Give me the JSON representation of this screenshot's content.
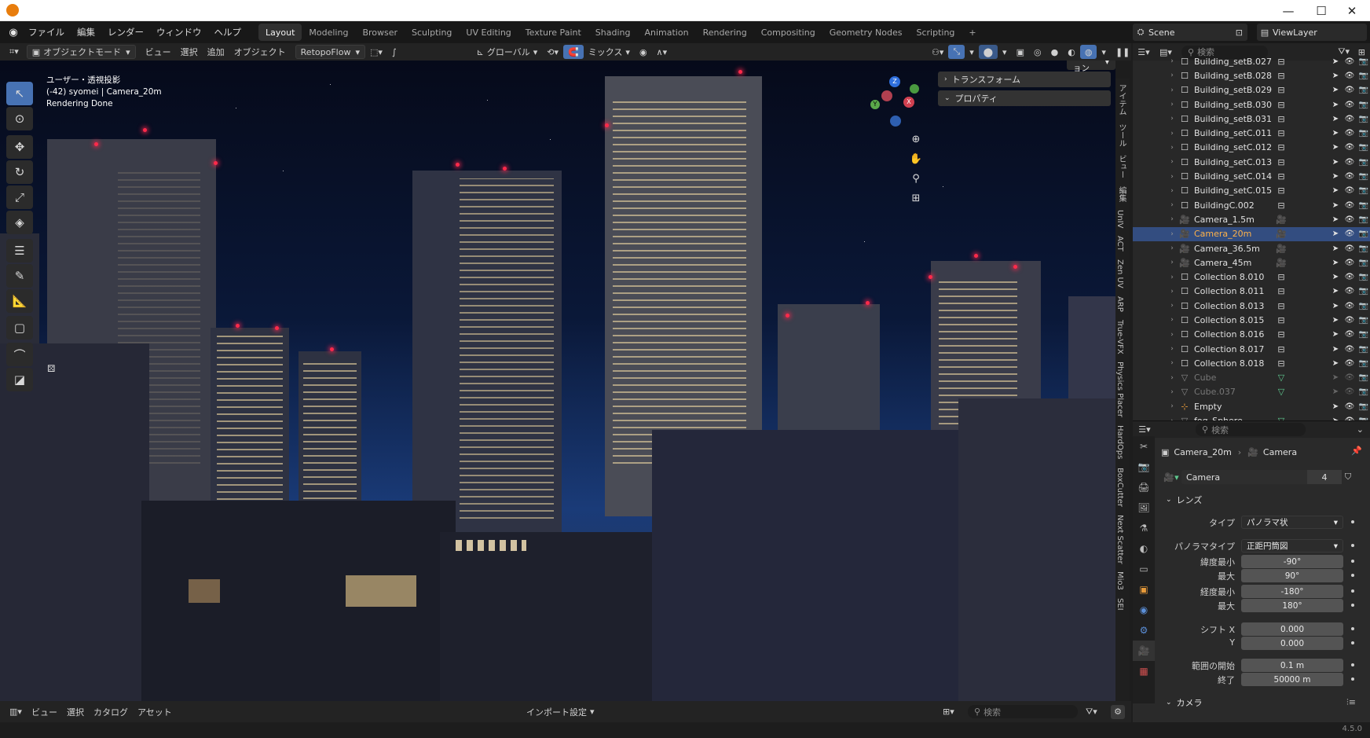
{
  "titlebar": {
    "min": "—",
    "max": "☐",
    "close": "✕"
  },
  "menus": [
    "ファイル",
    "編集",
    "レンダー",
    "ウィンドウ",
    "ヘルプ"
  ],
  "workspaces": [
    "Layout",
    "Modeling",
    "Browser",
    "Sculpting",
    "UV Editing",
    "Texture Paint",
    "Shading",
    "Animation",
    "Rendering",
    "Compositing",
    "Geometry Nodes",
    "Scripting"
  ],
  "add_ws": "+",
  "scene": "Scene",
  "viewlayer": "ViewLayer",
  "viewport_header": {
    "mode": "オブジェクトモード",
    "menus": [
      "ビュー",
      "選択",
      "追加",
      "オブジェクト"
    ],
    "addon": "RetopoFlow",
    "transform": "グローバル",
    "snap": "ミックス"
  },
  "options_button": "オプション",
  "overlay": {
    "line1": "ユーザー・透視投影",
    "line2": "(-42) syomei | Camera_20m",
    "line3": "Rendering Done"
  },
  "n_panels": [
    "トランスフォーム",
    "プロパティ"
  ],
  "vertical_tabs": [
    "アイテム",
    "ツール",
    "ビュー",
    "編集",
    "UnIV",
    "ACT",
    "Zen UV",
    "ARP",
    "True-VFX",
    "Physics Placer",
    "HardOps",
    "BoxCutter",
    "Next Scatter",
    "Mio3",
    "SEI"
  ],
  "outliner": {
    "search_placeholder": "検索",
    "rows": [
      {
        "name": "Building_setB.027",
        "type": "collection",
        "sel": false,
        "dim": false
      },
      {
        "name": "Building_setB.028",
        "type": "collection",
        "sel": false,
        "dim": false
      },
      {
        "name": "Building_setB.029",
        "type": "collection",
        "sel": false,
        "dim": false
      },
      {
        "name": "Building_setB.030",
        "type": "collection",
        "sel": false,
        "dim": false
      },
      {
        "name": "Building_setB.031",
        "type": "collection",
        "sel": false,
        "dim": false
      },
      {
        "name": "Building_setC.011",
        "type": "collection",
        "sel": false,
        "dim": false
      },
      {
        "name": "Building_setC.012",
        "type": "collection",
        "sel": false,
        "dim": false
      },
      {
        "name": "Building_setC.013",
        "type": "collection",
        "sel": false,
        "dim": false
      },
      {
        "name": "Building_setC.014",
        "type": "collection",
        "sel": false,
        "dim": false
      },
      {
        "name": "Building_setC.015",
        "type": "collection",
        "sel": false,
        "dim": false
      },
      {
        "name": "BuildingC.002",
        "type": "collection",
        "sel": false,
        "dim": false
      },
      {
        "name": "Camera_1.5m",
        "type": "camera",
        "sel": false,
        "dim": false
      },
      {
        "name": "Camera_20m",
        "type": "camera",
        "sel": true,
        "dim": false
      },
      {
        "name": "Camera_36.5m",
        "type": "camera",
        "sel": false,
        "dim": false
      },
      {
        "name": "Camera_45m",
        "type": "camera",
        "sel": false,
        "dim": false
      },
      {
        "name": "Collection 8.010",
        "type": "collection",
        "sel": false,
        "dim": false
      },
      {
        "name": "Collection 8.011",
        "type": "collection",
        "sel": false,
        "dim": false
      },
      {
        "name": "Collection 8.013",
        "type": "collection",
        "sel": false,
        "dim": false
      },
      {
        "name": "Collection 8.015",
        "type": "collection",
        "sel": false,
        "dim": false
      },
      {
        "name": "Collection 8.016",
        "type": "collection",
        "sel": false,
        "dim": false
      },
      {
        "name": "Collection 8.017",
        "type": "collection",
        "sel": false,
        "dim": false
      },
      {
        "name": "Collection 8.018",
        "type": "collection",
        "sel": false,
        "dim": false
      },
      {
        "name": "Cube",
        "type": "mesh",
        "sel": false,
        "dim": true
      },
      {
        "name": "Cube.037",
        "type": "mesh",
        "sel": false,
        "dim": true
      },
      {
        "name": "Empty",
        "type": "empty",
        "sel": false,
        "dim": false
      },
      {
        "name": "fog_Sphere",
        "type": "mesh",
        "sel": false,
        "dim": false
      }
    ]
  },
  "properties": {
    "search_placeholder": "検索",
    "breadcrumb_object": "Camera_20m",
    "breadcrumb_data": "Camera",
    "datablock": "Camera",
    "users": "4",
    "lens_section": "レンズ",
    "fields": [
      {
        "label": "タイプ",
        "value": "パノラマ状",
        "kind": "dropdown"
      },
      {
        "label": "パノラマタイプ",
        "value": "正距円筒図",
        "kind": "dropdown"
      },
      {
        "label": "緯度最小",
        "value": "-90°",
        "kind": "num"
      },
      {
        "label": "最大",
        "value": "90°",
        "kind": "num"
      },
      {
        "label": "経度最小",
        "value": "-180°",
        "kind": "num"
      },
      {
        "label": "最大",
        "value": "180°",
        "kind": "num"
      },
      {
        "label": "シフト X",
        "value": "0.000",
        "kind": "num"
      },
      {
        "label": "Y",
        "value": "0.000",
        "kind": "num"
      },
      {
        "label": "範囲の開始",
        "value": "0.1 m",
        "kind": "num"
      },
      {
        "label": "終了",
        "value": "50000 m",
        "kind": "num"
      }
    ],
    "camera_section": "カメラ"
  },
  "bottom": {
    "menus": [
      "ビュー",
      "選択",
      "カタログ",
      "アセット"
    ],
    "import": "インポート設定",
    "search_placeholder": "検索"
  },
  "version": "4.5.0",
  "colors": {
    "accent": "#4772b3",
    "selected_row": "#334d80",
    "camera_icon": "#e69a3a",
    "collection_icon": "#cfcfcf",
    "camera_data": "#5fc98f"
  }
}
